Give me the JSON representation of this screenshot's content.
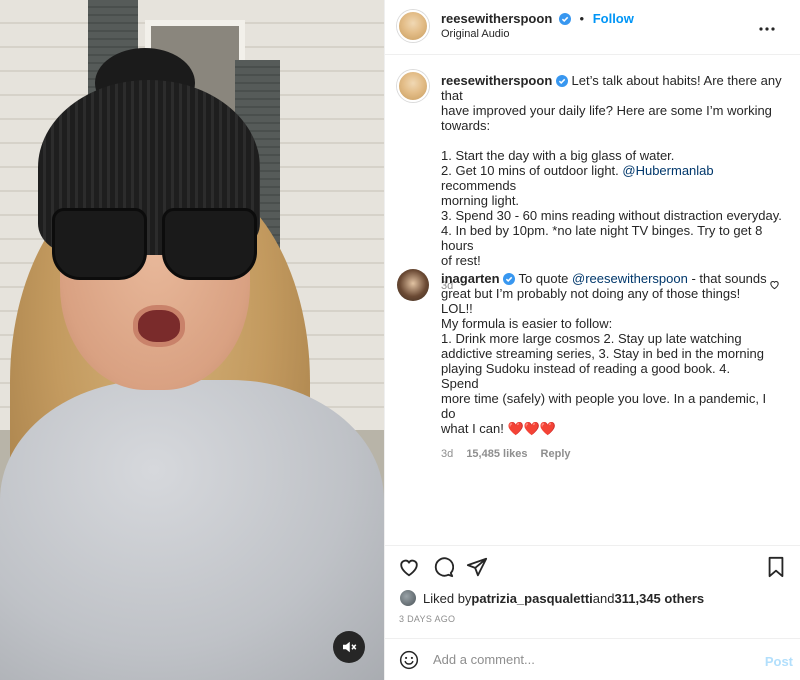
{
  "header": {
    "username": "reesewitherspoon",
    "separator": "•",
    "follow_label": "Follow",
    "audio": "Original Audio",
    "more_icon": "more-horizontal-icon"
  },
  "caption": {
    "username": "reesewitherspoon",
    "text_1": "Let’s talk about habits! Are there any that",
    "text_2": "have improved your daily life? Here are some I’m working",
    "text_3": "towards:",
    "item_1": "1. Start the day with a big glass of water.",
    "item_2_a": "2. Get 10 mins of outdoor light. ",
    "item_2_mention": "@Hubermanlab",
    "item_2_b": " recommends",
    "item_2_c": "morning light.",
    "item_3": "3. Spend 30 - 60 mins reading without distraction everyday.",
    "item_4_a": "4. In bed by 10pm. *no late night TV binges. Try to get  8 hours",
    "item_4_b": "of rest!",
    "age": "3d"
  },
  "comment": {
    "username": "inagarten",
    "text_pre": "To quote ",
    "mention": "@reesewitherspoon",
    "text_a": " - that sounds",
    "line_2": "great but I’m probably not doing any of those things! LOL!!",
    "line_3": "My formula is easier to follow:",
    "line_4": "1. Drink more large cosmos 2. Stay up late watching",
    "line_5": "addictive streaming series, 3. Stay in bed in the morning",
    "line_6": "playing Sudoku instead of reading a good book. 4. Spend",
    "line_7": "more time (safely) with people you love. In a pandemic, I do",
    "line_8": "what I can! ❤️❤️❤️",
    "age": "3d",
    "likes": "15,485 likes",
    "reply_label": "Reply"
  },
  "likes": {
    "prefix": "Liked by ",
    "user": "patrizia_pasqualetti",
    "middle": " and ",
    "count": "311,345 others"
  },
  "date": "3 DAYS AGO",
  "comment_bar": {
    "placeholder": "Add a comment...",
    "post_label": "Post"
  },
  "colors": {
    "accent": "#0095f6",
    "verified": "#3897f0",
    "heart": "#ed4956",
    "muted": "#8e8e8e"
  }
}
